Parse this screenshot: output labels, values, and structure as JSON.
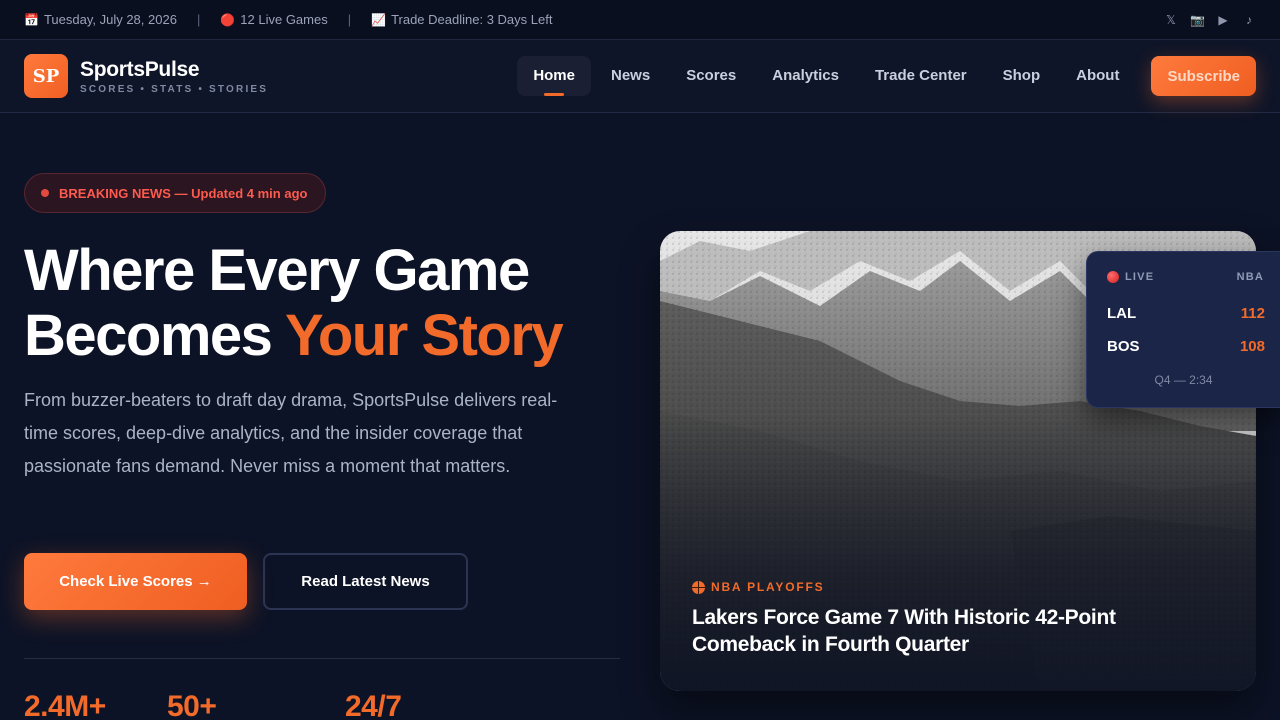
{
  "topbar": {
    "date_icon": "📅",
    "date": "Tuesday, July 28, 2026",
    "live_icon": "🔴",
    "live_games": "12 Live Games",
    "trade_icon": "📈",
    "trade_deadline": "Trade Deadline: 3 Days Left",
    "social": [
      "x-icon",
      "instagram-icon",
      "youtube-icon",
      "tiktok-icon"
    ],
    "social_glyphs": [
      "𝕏",
      "📷",
      "▶",
      "♪"
    ]
  },
  "header": {
    "logo_text": "SP",
    "brand_name": "SportsPulse",
    "brand_tagline": "SCORES • STATS • STORIES",
    "nav": [
      {
        "label": "Home",
        "active": true
      },
      {
        "label": "News"
      },
      {
        "label": "Scores"
      },
      {
        "label": "Analytics"
      },
      {
        "label": "Trade Center"
      },
      {
        "label": "Shop"
      },
      {
        "label": "About"
      }
    ],
    "subscribe_label": "Subscribe"
  },
  "hero": {
    "badge": "BREAKING NEWS — Updated 4 min ago",
    "headline_line1": "Where Every Game",
    "headline_line2_plain": "Becomes ",
    "headline_line2_accent": "Your Story",
    "lead": "From buzzer-beaters to draft day drama, SportsPulse delivers real-time scores, deep-dive analytics, and the insider coverage that passionate fans demand. Never miss a moment that matters.",
    "primary_cta": "Check Live Scores →",
    "secondary_cta": "Read Latest News",
    "stats": [
      "2.4M+",
      "50+",
      "24/7"
    ]
  },
  "feature_card": {
    "category": "NBA PLAYOFFS",
    "title": "Lakers Force Game 7 With Historic 42-Point Comeback in Fourth Quarter"
  },
  "live_widget": {
    "status": "LIVE",
    "league": "NBA",
    "home_team": "LAL",
    "home_score": "112",
    "away_team": "BOS",
    "away_score": "108",
    "clock": "Q4 — 2:34"
  },
  "colors": {
    "accent": "#f26b2a",
    "background": "#0d1326",
    "breaking": "#ff5a4e"
  }
}
